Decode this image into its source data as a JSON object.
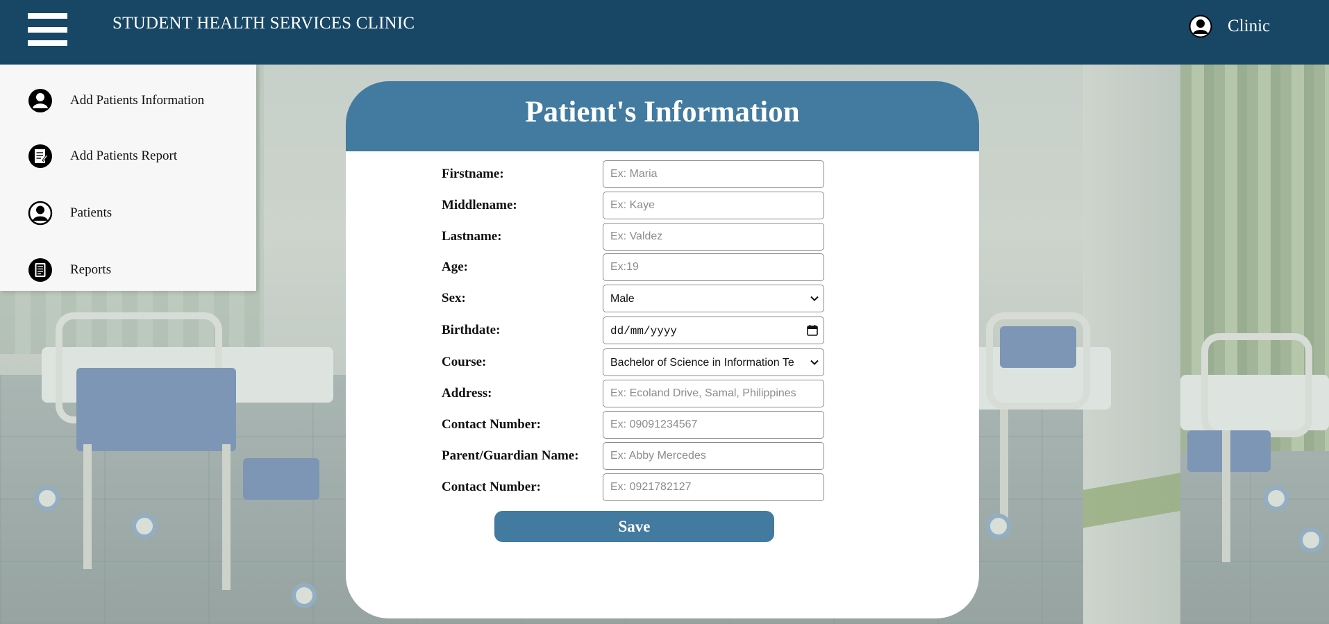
{
  "header": {
    "app_title": "STUDENT HEALTH SERVICES CLINIC",
    "user_label": "Clinic",
    "background_color": "#184766"
  },
  "sidebar": {
    "items": [
      {
        "label": "Add Patients Information",
        "icon": "user-circle-icon"
      },
      {
        "label": "Add Patients Report",
        "icon": "report-document-icon"
      },
      {
        "label": "Patients",
        "icon": "user-circle-outline-icon"
      },
      {
        "label": "Reports",
        "icon": "reports-list-icon"
      }
    ]
  },
  "form": {
    "title": "Patient's Information",
    "accent_color": "#427aa0",
    "fields": {
      "firstname": {
        "label": "Firstname:",
        "placeholder": "Ex: Maria",
        "value": ""
      },
      "middlename": {
        "label": "Middlename:",
        "placeholder": "Ex: Kaye",
        "value": ""
      },
      "lastname": {
        "label": "Lastname:",
        "placeholder": "Ex: Valdez",
        "value": ""
      },
      "age": {
        "label": "Age:",
        "placeholder": "Ex:19",
        "value": ""
      },
      "sex": {
        "label": "Sex:",
        "selected": "Male"
      },
      "birthdate": {
        "label": "Birthdate:",
        "value": "dd/mm/yyyy"
      },
      "course": {
        "label": "Course:",
        "selected": "Bachelor of Science in Information Te"
      },
      "address": {
        "label": "Address:",
        "placeholder": "Ex: Ecoland Drive, Samal, Philippines",
        "value": ""
      },
      "contact": {
        "label": "Contact Number:",
        "placeholder": "Ex: 09091234567",
        "value": ""
      },
      "guardian": {
        "label": "Parent/Guardian Name:",
        "placeholder": "Ex: Abby Mercedes",
        "value": ""
      },
      "guardian_contact": {
        "label": "Contact Number:",
        "placeholder": "Ex: 0921782127",
        "value": ""
      }
    },
    "save_label": "Save"
  }
}
